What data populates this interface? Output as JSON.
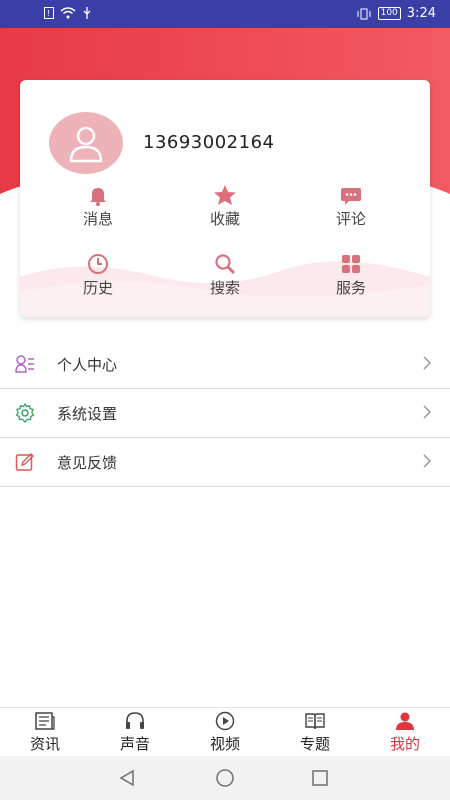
{
  "status_bar": {
    "time": "3:24",
    "battery": "100",
    "left_icons": [
      "notification-icon",
      "wifi-icon",
      "usb-icon"
    ],
    "right_icons": [
      "vibrate-icon",
      "battery-icon"
    ]
  },
  "profile": {
    "phone": "13693002164",
    "avatar_icon": "user-avatar-icon"
  },
  "quick_actions": [
    {
      "label": "消息",
      "icon": "bell-icon"
    },
    {
      "label": "收藏",
      "icon": "star-icon"
    },
    {
      "label": "评论",
      "icon": "comment-icon"
    },
    {
      "label": "历史",
      "icon": "clock-icon"
    },
    {
      "label": "搜索",
      "icon": "search-icon"
    },
    {
      "label": "服务",
      "icon": "grid-icon"
    }
  ],
  "menu": [
    {
      "label": "个人中心",
      "icon": "person-list-icon"
    },
    {
      "label": "系统设置",
      "icon": "gear-icon"
    },
    {
      "label": "意见反馈",
      "icon": "edit-icon"
    }
  ],
  "tabs": [
    {
      "label": "资讯",
      "icon": "news-icon",
      "active": false
    },
    {
      "label": "声音",
      "icon": "headphones-icon",
      "active": false
    },
    {
      "label": "视频",
      "icon": "play-icon",
      "active": false
    },
    {
      "label": "专题",
      "icon": "book-icon",
      "active": false
    },
    {
      "label": "我的",
      "icon": "user-icon",
      "active": true
    }
  ],
  "colors": {
    "accent": "#e0343f",
    "header": "#ee4a55",
    "icon_pink": "#d9707d",
    "status_bar": "#3a3fa8"
  }
}
